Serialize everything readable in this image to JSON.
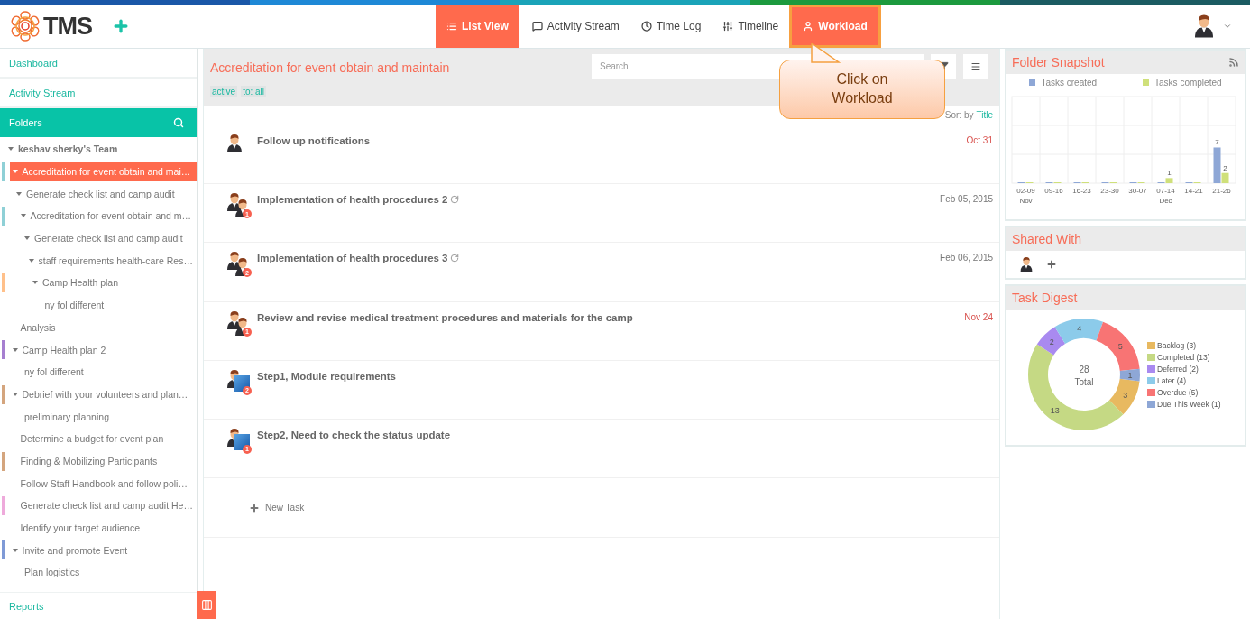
{
  "header": {
    "logo": "TMS",
    "tabs": [
      {
        "label": "List View",
        "selected": true,
        "highlighted": false
      },
      {
        "label": "Activity Stream",
        "selected": false,
        "highlighted": false
      },
      {
        "label": "Time Log",
        "selected": false,
        "highlighted": false
      },
      {
        "label": "Timeline",
        "selected": false,
        "highlighted": false
      },
      {
        "label": "Workload",
        "selected": false,
        "highlighted": true
      }
    ]
  },
  "callout": {
    "text": "Click on Workload"
  },
  "sidebar": {
    "links": [
      "Dashboard",
      "Activity Stream"
    ],
    "folders_title": "Folders",
    "footer_link": "Reports",
    "tree": [
      {
        "label": "keshav sherky's Team",
        "expanded": true,
        "selected": false,
        "children": [
          {
            "label": "Accreditation for event obtain and mai…",
            "color": "#8fd0d6",
            "expanded": true,
            "selected": true,
            "children": [
              {
                "label": "Generate check list and camp audit",
                "expanded": true,
                "selected": false,
                "children": [
                  {
                    "label": "Accreditation for event obtain and m…",
                    "color": "#8fd0d6",
                    "expanded": true,
                    "selected": false,
                    "children": [
                      {
                        "label": "Generate check list and camp audit",
                        "expanded": true,
                        "selected": false,
                        "children": [
                          {
                            "label": "staff requirements health-care Res…",
                            "expanded": true,
                            "selected": false,
                            "children": [
                              {
                                "label": "Camp Health plan",
                                "color": "#ffc08a",
                                "expanded": true,
                                "selected": false,
                                "children": [
                                  {
                                    "label": "ny fol different",
                                    "selected": false
                                  }
                                ]
                              }
                            ]
                          }
                        ]
                      }
                    ]
                  }
                ]
              }
            ]
          },
          {
            "label": "Analysis",
            "selected": false
          },
          {
            "label": "Camp Health plan 2",
            "color": "#a67fd0",
            "expanded": true,
            "selected": false,
            "children": [
              {
                "label": "ny fol different",
                "selected": false
              }
            ]
          },
          {
            "label": "Debrief with your volunteers and plan…",
            "color": "#d4a57e",
            "expanded": true,
            "selected": false,
            "children": [
              {
                "label": "preliminary planning",
                "selected": false
              }
            ]
          },
          {
            "label": "Determine a budget for event plan",
            "selected": false
          },
          {
            "label": "Finding & Mobilizing Participants",
            "color": "#d4a57e",
            "selected": false
          },
          {
            "label": "Follow Staff Handbook and follow poli…",
            "selected": false
          },
          {
            "label": "Generate check list and camp audit He…",
            "color": "#eeaadb",
            "selected": false
          },
          {
            "label": "Identify your target audience",
            "selected": false
          },
          {
            "label": "Invite and promote Event",
            "color": "#7f9ad6",
            "expanded": true,
            "selected": false,
            "children": [
              {
                "label": "Plan logistics",
                "selected": false
              }
            ]
          }
        ]
      }
    ]
  },
  "main": {
    "title": "Accreditation for event obtain and maintain",
    "tags": [
      "active",
      "to: all"
    ],
    "search": {
      "placeholder": "Search"
    },
    "sort": {
      "label": "Sort by",
      "value": "Title"
    },
    "tasks": [
      {
        "title": "Follow up notifications",
        "kind": "single",
        "date": "Oct 31",
        "overdue": true,
        "recurring": false
      },
      {
        "title": "Implementation of health procedures 2",
        "kind": "pair",
        "badge": "1",
        "date": "Feb 05, 2015",
        "overdue": false,
        "recurring": true
      },
      {
        "title": "Implementation of health procedures 3",
        "kind": "pair",
        "badge": "2",
        "date": "Feb 06, 2015",
        "overdue": false,
        "recurring": true
      },
      {
        "title": "Review and revise medical treatment procedures and materials for the camp",
        "kind": "pair",
        "badge": "1",
        "date": "Nov 24",
        "overdue": true,
        "recurring": false
      },
      {
        "title": "Step1, Module requirements",
        "kind": "image",
        "badge": "2",
        "recurring": false
      },
      {
        "title": "Step2, Need to check the status update",
        "kind": "image",
        "badge": "1",
        "recurring": false
      }
    ],
    "new_task": "New Task"
  },
  "right": {
    "snapshot": {
      "title": "Folder Snapshot",
      "chart_data": {
        "type": "bar",
        "categories": [
          "02-09\nNov",
          "09-16",
          "16-23",
          "23-30",
          "30-07",
          "07-14\nDec",
          "14-21",
          "21-26"
        ],
        "legend": "top",
        "series": [
          {
            "name": "Tasks created",
            "color": "#8ea7d6",
            "values": [
              0,
              0,
              0,
              0,
              0,
              0,
              0,
              7
            ],
            "value_labels": [
              null,
              null,
              null,
              null,
              null,
              null,
              null,
              "7"
            ]
          },
          {
            "name": "Tasks completed",
            "color": "#cfe07a",
            "values": [
              0,
              0,
              0,
              0,
              0,
              1,
              0,
              2
            ],
            "value_labels": [
              null,
              null,
              null,
              null,
              null,
              "1",
              null,
              "2"
            ]
          }
        ]
      }
    },
    "shared": {
      "title": "Shared With"
    },
    "digest": {
      "title": "Task Digest",
      "chart_data": {
        "type": "donut",
        "data_labels": true,
        "legend": "right",
        "categories": [
          "Backlog (3)",
          "Completed (13)",
          "Deferred (2)",
          "Later (4)",
          "Overdue (5)",
          "Due This Week (1)"
        ],
        "values": [
          3,
          13,
          2,
          4,
          5,
          1
        ],
        "colors": [
          "#e8b960",
          "#c5d984",
          "#a98af0",
          "#8ccbea",
          "#f87474",
          "#8ea7d6"
        ]
      },
      "center_value": "28",
      "center_label": "Total"
    }
  }
}
